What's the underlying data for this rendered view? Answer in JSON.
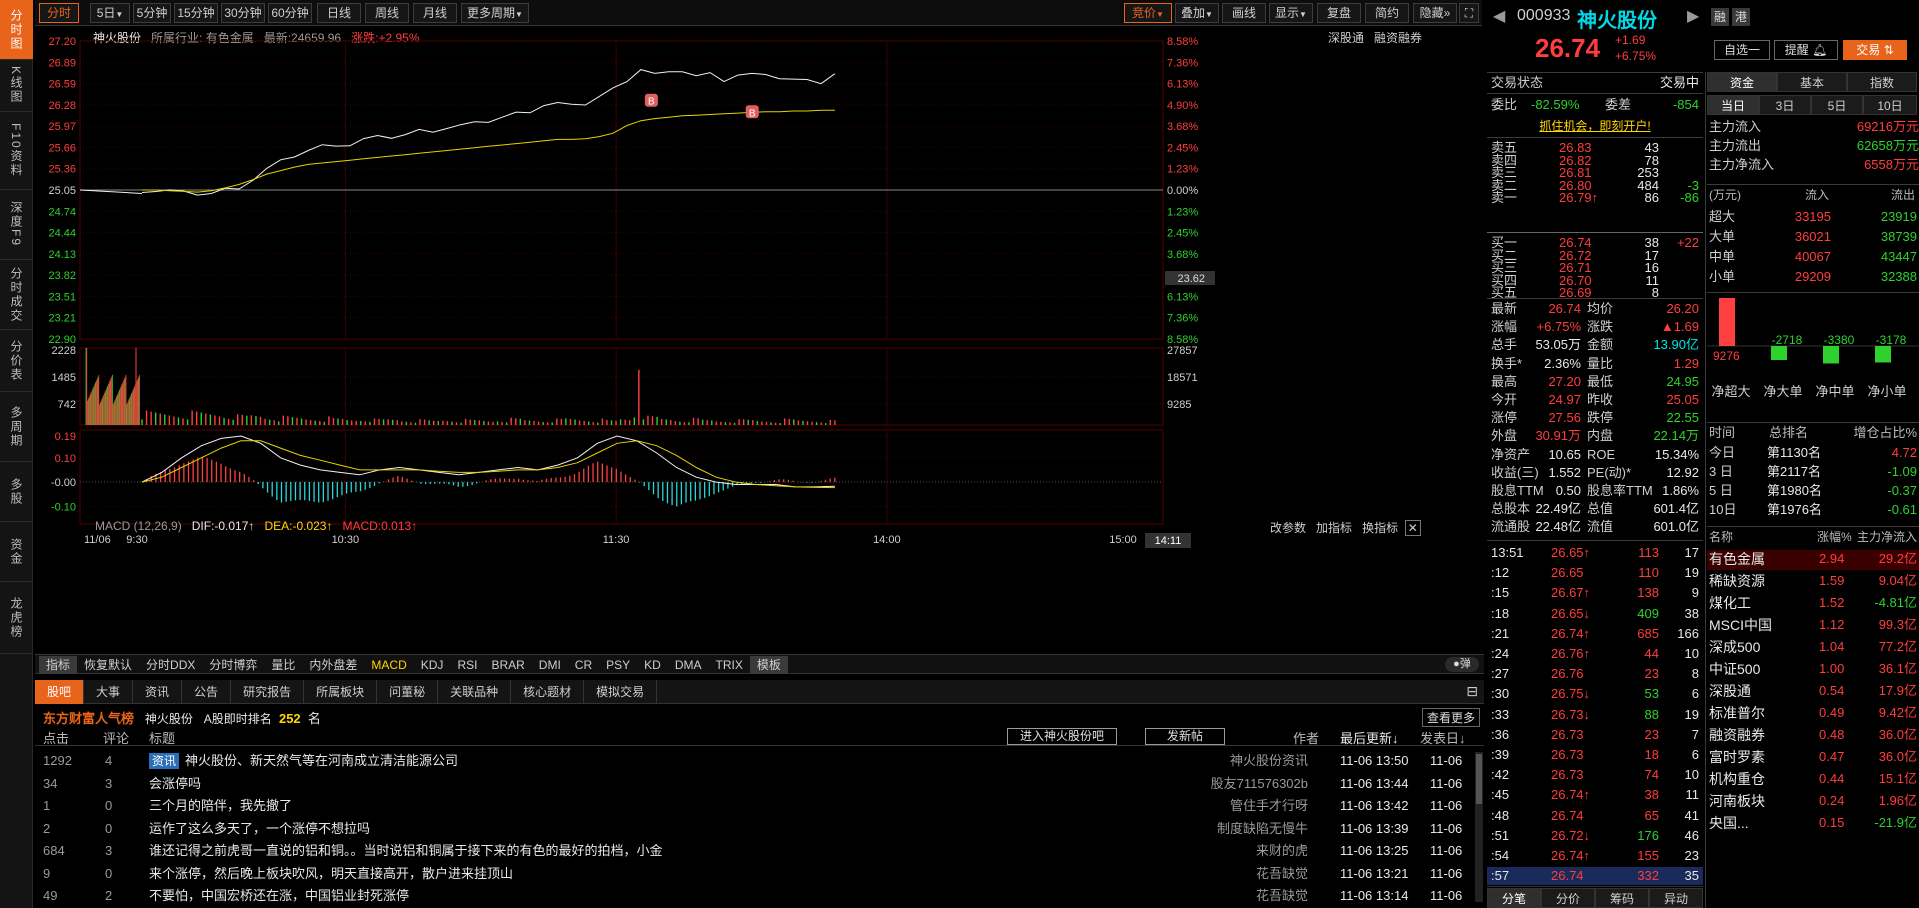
{
  "left_tabs": [
    "分时图",
    "K线图",
    "F10资料",
    "深度F9",
    "分时成交",
    "分价表",
    "多周期",
    "多股",
    "资金",
    "龙虎榜"
  ],
  "toolbar": {
    "periods": [
      "分时",
      "5日",
      "5分钟",
      "15分钟",
      "30分钟",
      "60分钟",
      "日线",
      "周线",
      "月线",
      "更多周期"
    ],
    "right": [
      "竞价",
      "叠加",
      "画线",
      "显示",
      "复盘",
      "简约",
      "隐藏"
    ]
  },
  "chart_info": {
    "name": "神火股份",
    "industry": "所属行业: 有色金属",
    "latest": "最新:24659.96",
    "change": "涨跌:+2.95%",
    "links": [
      "深股通",
      "融资融券"
    ]
  },
  "chart_data": {
    "type": "line",
    "x_ticks": [
      "9:30",
      "10:30",
      "11:30",
      "14:00",
      "15:00"
    ],
    "x_date": "11/06",
    "cursor_time": "14:11",
    "price_axis": [
      "27.20",
      "26.89",
      "26.59",
      "26.28",
      "25.97",
      "25.66",
      "25.36",
      "25.05",
      "24.74",
      "24.44",
      "24.13",
      "23.82",
      "23.51",
      "23.21",
      "22.90"
    ],
    "pct_axis": [
      "8.58%",
      "7.36%",
      "6.13%",
      "4.90%",
      "3.68%",
      "2.45%",
      "1.23%",
      "0.00%",
      "1.23%",
      "2.45%",
      "3.68%",
      "4.90%",
      "6.13%",
      "7.36%",
      "8.58%"
    ],
    "cursor_price": "23.62",
    "prev_close": 25.05,
    "ylim": [
      22.9,
      27.2
    ],
    "series": [
      {
        "name": "价格",
        "values": [
          25.05,
          25.04,
          25.04,
          25.0,
          25.0,
          25.0,
          25.05,
          25.1,
          25.2,
          25.35,
          25.45,
          25.55,
          25.62,
          25.68,
          25.72,
          25.7,
          25.78,
          25.8,
          25.82,
          25.85,
          25.9,
          25.92,
          25.95,
          25.98,
          26.0,
          26.05,
          26.1,
          26.15,
          26.2,
          26.28,
          26.3,
          26.25,
          26.3,
          26.4,
          26.5,
          26.65,
          26.8,
          26.72,
          26.72,
          26.78,
          26.7,
          26.72,
          26.65,
          26.72,
          26.72,
          26.68,
          26.68,
          26.65,
          26.62,
          26.62,
          26.74
        ]
      },
      {
        "name": "均价",
        "values": [
          25.05,
          25.05,
          25.04,
          25.03,
          25.02,
          25.04,
          25.08,
          25.13,
          25.2,
          25.28,
          25.33,
          25.38,
          25.42,
          25.44,
          25.46,
          25.48,
          25.5,
          25.52,
          25.54,
          25.56,
          25.58,
          25.6,
          25.62,
          25.64,
          25.66,
          25.68,
          25.7,
          25.72,
          25.74,
          25.76,
          25.78,
          25.78,
          25.79,
          25.82,
          25.87,
          25.98,
          26.05,
          26.08,
          26.1,
          26.12,
          26.13,
          26.14,
          26.15,
          26.16,
          26.17,
          26.18,
          26.18,
          26.19,
          26.19,
          26.2,
          26.2
        ]
      }
    ],
    "volume": {
      "axis_left": [
        "2228",
        "1485",
        "742"
      ],
      "axis_right": [
        "27857",
        "18571",
        "9285"
      ],
      "ylim": [
        0,
        2228
      ],
      "values": [
        2228,
        1400,
        900,
        600,
        500,
        420,
        380,
        300,
        340,
        290,
        260,
        250,
        230,
        240,
        210,
        190,
        220,
        180,
        200,
        170,
        160,
        150,
        180,
        170,
        160,
        150,
        190,
        200,
        170,
        160,
        180,
        210,
        190,
        180,
        150,
        220,
        1600,
        260,
        210,
        180,
        200,
        170,
        150,
        160,
        170,
        150,
        140,
        180,
        160,
        150,
        140
      ]
    },
    "macd": {
      "label": "MACD (12,26,9)",
      "dif": "DIF:-0.017↑",
      "dea": "DEA:-0.023↑",
      "macd": "MACD:0.013↑",
      "axis": [
        "0.19",
        "0.10",
        "-0.00",
        "-0.10"
      ],
      "buttons": [
        "改参数",
        "加指标",
        "换指标"
      ],
      "ylim": [
        -0.14,
        0.19
      ],
      "dif_values": [
        0.0,
        0.04,
        0.1,
        0.15,
        0.18,
        0.19,
        0.16,
        0.1,
        0.07,
        0.05,
        0.04,
        0.03,
        0.05,
        0.06,
        0.05,
        0.04,
        0.03,
        0.04,
        0.05,
        0.06,
        0.05,
        0.07,
        0.1,
        0.16,
        0.19,
        0.17,
        0.12,
        0.06,
        0.02,
        0.0,
        -0.01,
        -0.01,
        -0.01,
        -0.02,
        -0.02,
        -0.017
      ],
      "dea_values": [
        0.0,
        0.02,
        0.06,
        0.1,
        0.14,
        0.17,
        0.17,
        0.14,
        0.11,
        0.09,
        0.07,
        0.05,
        0.05,
        0.05,
        0.05,
        0.045,
        0.04,
        0.04,
        0.045,
        0.05,
        0.05,
        0.06,
        0.08,
        0.12,
        0.16,
        0.17,
        0.15,
        0.11,
        0.06,
        0.02,
        0.0,
        -0.01,
        -0.015,
        -0.02,
        -0.022,
        -0.023
      ]
    },
    "markers": [
      "B",
      "B"
    ]
  },
  "indicator_tabs": [
    "指标",
    "恢复默认",
    "分时DDX",
    "分时博弈",
    "量比",
    "内外盘差",
    "MACD",
    "KDJ",
    "RSI",
    "BRAR",
    "DMI",
    "CR",
    "PSY",
    "KD",
    "DMA",
    "TRIX",
    "模板"
  ],
  "toggle_label": "弹",
  "stock": {
    "code": "000933",
    "name": "神火股份",
    "price": "26.74",
    "change": "+1.69",
    "change_pct": "+6.75%",
    "tags": [
      "融",
      "港"
    ],
    "buttons": [
      "自选一",
      "提醒",
      "交易"
    ]
  },
  "status": {
    "label": "交易状态",
    "value": "交易中"
  },
  "webi": {
    "l1": "委比",
    "v1": "-82.59%",
    "l2": "委差",
    "v2": "-854"
  },
  "promo": "抓住机会，即刻开户!",
  "sell": [
    {
      "l": "卖五",
      "p": "26.83",
      "v": "43",
      "d": ""
    },
    {
      "l": "卖四",
      "p": "26.82",
      "v": "78",
      "d": ""
    },
    {
      "l": "卖三",
      "p": "26.81",
      "v": "253",
      "d": ""
    },
    {
      "l": "卖二",
      "p": "26.80",
      "v": "484",
      "d": "-3"
    },
    {
      "l": "卖一",
      "p": "26.79↑",
      "v": "86",
      "d": "-86"
    }
  ],
  "buy": [
    {
      "l": "买一",
      "p": "26.74",
      "v": "38",
      "d": "+22"
    },
    {
      "l": "买二",
      "p": "26.72",
      "v": "17",
      "d": ""
    },
    {
      "l": "买三",
      "p": "26.71",
      "v": "16",
      "d": ""
    },
    {
      "l": "买四",
      "p": "26.70",
      "v": "11",
      "d": ""
    },
    {
      "l": "买五",
      "p": "26.69",
      "v": "8",
      "d": ""
    }
  ],
  "quote": [
    {
      "l1": "最新",
      "v1": "26.74",
      "l2": "均价",
      "v2": "26.20"
    },
    {
      "l1": "涨幅",
      "v1": "+6.75%",
      "l2": "涨跌",
      "v2": "▲1.69"
    },
    {
      "l1": "总手",
      "v1": "53.05万",
      "l2": "金额",
      "v2": "13.90亿"
    },
    {
      "l1": "换手*",
      "v1": "2.36%",
      "l2": "量比",
      "v2": "1.29"
    },
    {
      "l1": "最高",
      "v1": "27.20",
      "l2": "最低",
      "v2": "24.95"
    },
    {
      "l1": "今开",
      "v1": "24.97",
      "l2": "昨收",
      "v2": "25.05"
    },
    {
      "l1": "涨停",
      "v1": "27.56",
      "l2": "跌停",
      "v2": "22.55"
    },
    {
      "l1": "外盘",
      "v1": "30.91万",
      "l2": "内盘",
      "v2": "22.14万"
    },
    {
      "l1": "净资产",
      "v1": "10.65",
      "l2": "ROE",
      "v2": "15.34%"
    },
    {
      "l1": "收益(三)",
      "v1": "1.552",
      "l2": "PE(动)*",
      "v2": "12.92"
    },
    {
      "l1": "股息TTM",
      "v1": "0.50",
      "l2": "股息率TTM",
      "v2": "1.86%"
    },
    {
      "l1": "总股本",
      "v1": "22.49亿",
      "l2": "总值",
      "v2": "601.4亿"
    },
    {
      "l1": "流通股",
      "v1": "22.48亿",
      "l2": "流值",
      "v2": "601.0亿"
    }
  ],
  "ticks": [
    {
      "t": "13:51",
      "p": "26.65↑",
      "v": "113",
      "n": "17"
    },
    {
      "t": ":12",
      "p": "26.65",
      "v": "110",
      "n": "19"
    },
    {
      "t": ":15",
      "p": "26.67↑",
      "v": "138",
      "n": "9"
    },
    {
      "t": ":18",
      "p": "26.65↓",
      "v": "409",
      "n": "38"
    },
    {
      "t": ":21",
      "p": "26.74↑",
      "v": "685",
      "n": "166"
    },
    {
      "t": ":24",
      "p": "26.76↑",
      "v": "44",
      "n": "10"
    },
    {
      "t": ":27",
      "p": "26.76",
      "v": "23",
      "n": "8"
    },
    {
      "t": ":30",
      "p": "26.75↓",
      "v": "53",
      "n": "6"
    },
    {
      "t": ":33",
      "p": "26.73↓",
      "v": "88",
      "n": "19"
    },
    {
      "t": ":36",
      "p": "26.73",
      "v": "23",
      "n": "7"
    },
    {
      "t": ":39",
      "p": "26.73",
      "v": "18",
      "n": "6"
    },
    {
      "t": ":42",
      "p": "26.73",
      "v": "74",
      "n": "10"
    },
    {
      "t": ":45",
      "p": "26.74↑",
      "v": "38",
      "n": "11"
    },
    {
      "t": ":48",
      "p": "26.74",
      "v": "65",
      "n": "41"
    },
    {
      "t": ":51",
      "p": "26.72↓",
      "v": "176",
      "n": "46"
    },
    {
      "t": ":54",
      "p": "26.74↑",
      "v": "155",
      "n": "23"
    },
    {
      "t": ":57",
      "p": "26.74",
      "v": "332",
      "n": "35"
    }
  ],
  "tick_tabs": [
    "分笔",
    "分价",
    "筹码",
    "异动"
  ],
  "fund_tabs": [
    "资金",
    "基本",
    "指数"
  ],
  "period_tabs": [
    "当日",
    "3日",
    "5日",
    "10日"
  ],
  "flow": [
    {
      "l": "主力流入",
      "v": "69216万元"
    },
    {
      "l": "主力流出",
      "v": "62658万元"
    },
    {
      "l": "主力净流入",
      "v": "6558万元"
    }
  ],
  "flow_table": {
    "header": [
      "(万元)",
      "流入",
      "流出"
    ],
    "rows": [
      {
        "l": "超大",
        "in": "33195",
        "out": "23919"
      },
      {
        "l": "大单",
        "in": "36021",
        "out": "38739"
      },
      {
        "l": "中单",
        "in": "40067",
        "out": "43447"
      },
      {
        "l": "小单",
        "in": "29209",
        "out": "32388"
      }
    ]
  },
  "net_bars": {
    "values": [
      9276,
      -2718,
      -3380,
      -3178
    ],
    "labels": [
      "净超大",
      "净大单",
      "净中单",
      "净小单"
    ]
  },
  "rank": {
    "header": [
      "时间",
      "总排名",
      "增仓占比%"
    ],
    "rows": [
      {
        "t": "今日",
        "r": "第1130名",
        "v": "4.72"
      },
      {
        "t": "3 日",
        "r": "第2117名",
        "v": "-1.09"
      },
      {
        "t": "5 日",
        "r": "第1980名",
        "v": "-0.37"
      },
      {
        "t": "10日",
        "r": "第1976名",
        "v": "-0.61"
      }
    ]
  },
  "sectors": {
    "header": [
      "名称",
      "涨幅%",
      "主力净流入"
    ],
    "rows": [
      {
        "n": "有色金属",
        "c": "2.94",
        "f": "29.2亿"
      },
      {
        "n": "稀缺资源",
        "c": "1.59",
        "f": "9.04亿"
      },
      {
        "n": "煤化工",
        "c": "1.52",
        "f": "-4.81亿"
      },
      {
        "n": "MSCI中国",
        "c": "1.12",
        "f": "99.3亿"
      },
      {
        "n": "深成500",
        "c": "1.04",
        "f": "77.2亿"
      },
      {
        "n": "中证500",
        "c": "1.00",
        "f": "36.1亿"
      },
      {
        "n": "深股通",
        "c": "0.54",
        "f": "17.9亿"
      },
      {
        "n": "标准普尔",
        "c": "0.49",
        "f": "9.42亿"
      },
      {
        "n": "融资融券",
        "c": "0.48",
        "f": "36.0亿"
      },
      {
        "n": "富时罗素",
        "c": "0.47",
        "f": "36.0亿"
      },
      {
        "n": "机构重仓",
        "c": "0.44",
        "f": "15.1亿"
      },
      {
        "n": "河南板块",
        "c": "0.24",
        "f": "1.96亿"
      },
      {
        "n": "央国...",
        "c": "0.15",
        "f": "-21.9亿"
      }
    ]
  },
  "bottom": {
    "tabs": [
      "股吧",
      "大事",
      "资讯",
      "公告",
      "研究报告",
      "所属板块",
      "问董秘",
      "关联品种",
      "核心题材",
      "模拟交易"
    ],
    "popularity": "东方财富人气榜",
    "stock_name": "神火股份",
    "rank_label": "A股即时排名",
    "rank_value": "252",
    "rank_unit": "名",
    "more": "查看更多",
    "headers": [
      "点击",
      "评论",
      "标题",
      "作者",
      "最后更新↓",
      "发表日↓"
    ],
    "enter_btn": "进入神火股份吧",
    "post_btn": "发新帖",
    "news_tag": "资讯",
    "posts": [
      {
        "clicks": "1292",
        "comments": "4",
        "title": "神火股份、新天然气等在河南成立清洁能源公司",
        "author": "神火股份资讯",
        "updated": "11-06 13:50",
        "date": "11-06"
      },
      {
        "clicks": "34",
        "comments": "3",
        "title": "会涨停吗",
        "author": "股友711576302b",
        "updated": "11-06 13:44",
        "date": "11-06"
      },
      {
        "clicks": "1",
        "comments": "0",
        "title": "三个月的陪伴，我先撤了",
        "author": "管住手才行呀",
        "updated": "11-06 13:42",
        "date": "11-06"
      },
      {
        "clicks": "2",
        "comments": "0",
        "title": "运作了这么多天了，一个涨停不想拉吗",
        "author": "制度缺陷无慢牛",
        "updated": "11-06 13:39",
        "date": "11-06"
      },
      {
        "clicks": "684",
        "comments": "3",
        "title": "谁还记得之前虎哥一直说的铝和铜。。当时说铝和铜属于接下来的有色的最好的拍档，小金",
        "author": "来财的虎",
        "updated": "11-06 13:25",
        "date": "11-06"
      },
      {
        "clicks": "9",
        "comments": "0",
        "title": "来个涨停，然后晚上板块吹风，明天直接高开，散户进来挂顶山",
        "author": "花吾缺觉",
        "updated": "11-06 13:21",
        "date": "11-06"
      },
      {
        "clicks": "49",
        "comments": "2",
        "title": "不要怕，中国宏桥还在涨，中国铝业封死涨停",
        "author": "花吾缺觉",
        "updated": "11-06 13:14",
        "date": "11-06"
      }
    ]
  }
}
